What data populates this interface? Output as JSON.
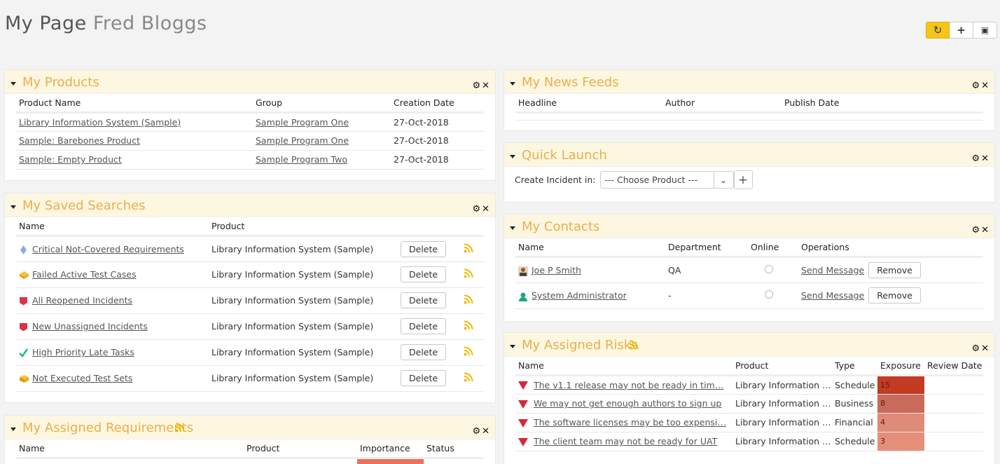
{
  "page": {
    "title": "My Page",
    "user": "Fred Bloggs"
  },
  "toolbar": {
    "refresh_icon": "↻",
    "add_icon": "+",
    "image_icon": "▣"
  },
  "panel_tools": {
    "settings": "⚙",
    "close": "✕"
  },
  "products": {
    "title": "My Products",
    "headers": [
      "Product Name",
      "Group",
      "Creation Date"
    ],
    "rows": [
      [
        "Library Information System (Sample)",
        "Sample Program One",
        "27-Oct-2018"
      ],
      [
        "Sample: Barebones Product",
        "Sample Program One",
        "27-Oct-2018"
      ],
      [
        "Sample: Empty Product",
        "Sample Program Two",
        "27-Oct-2018"
      ]
    ]
  },
  "saved_searches": {
    "title": "My Saved Searches",
    "headers": [
      "Name",
      "Product"
    ],
    "delete_label": "Delete",
    "rows": [
      {
        "name": "Critical Not-Covered Requirements",
        "product": "Library Information System (Sample)",
        "icon": "requirement-icon"
      },
      {
        "name": "Failed Active Test Cases",
        "product": "Library Information System (Sample)",
        "icon": "test-case-icon"
      },
      {
        "name": "All Reopened Incidents",
        "product": "Library Information System (Sample)",
        "icon": "incident-icon"
      },
      {
        "name": "New Unassigned Incidents",
        "product": "Library Information System (Sample)",
        "icon": "incident-icon"
      },
      {
        "name": "High Priority Late Tasks",
        "product": "Library Information System (Sample)",
        "icon": "task-icon"
      },
      {
        "name": "Not Executed Test Sets",
        "product": "Library Information System (Sample)",
        "icon": "test-set-icon"
      }
    ]
  },
  "assigned_requirements": {
    "title": "My Assigned Requirements",
    "headers": [
      "Name",
      "Product",
      "Importance",
      "Status"
    ]
  },
  "news_feeds": {
    "title": "My News Feeds",
    "headers": [
      "Headline",
      "Author",
      "Publish Date"
    ]
  },
  "quick_launch": {
    "title": "Quick Launch",
    "label": "Create Incident in:",
    "select_value": "--- Choose Product ---"
  },
  "contacts": {
    "title": "My Contacts",
    "headers": [
      "Name",
      "Department",
      "Online",
      "Operations"
    ],
    "send_label": "Send Message",
    "remove_label": "Remove",
    "rows": [
      {
        "name": "Joe P Smith",
        "department": "QA"
      },
      {
        "name": "System Administrator",
        "department": "-"
      }
    ]
  },
  "risks": {
    "title": "My Assigned Risks",
    "headers": [
      "Name",
      "Product",
      "Type",
      "Exposure",
      "Review Date"
    ],
    "rows": [
      {
        "name": "The v1.1 release may not be ready in tim…",
        "product": "Library Information …",
        "type": "Schedule",
        "exposure": "15",
        "color": "#c23b22"
      },
      {
        "name": "We may not get enough authors to sign up",
        "product": "Library Information …",
        "type": "Business",
        "exposure": "8",
        "color": "#c96a5a"
      },
      {
        "name": "The software licenses may be too expensi…",
        "product": "Library Information …",
        "type": "Financial",
        "exposure": "4",
        "color": "#e08b78"
      },
      {
        "name": "The client team may not be ready for UAT",
        "product": "Library Information …",
        "type": "Schedule",
        "exposure": "3",
        "color": "#e58f7a"
      }
    ]
  },
  "colors": {
    "accent": "#e8b04e",
    "header_bg": "#fdf6e0",
    "active_button": "#f5c518"
  }
}
